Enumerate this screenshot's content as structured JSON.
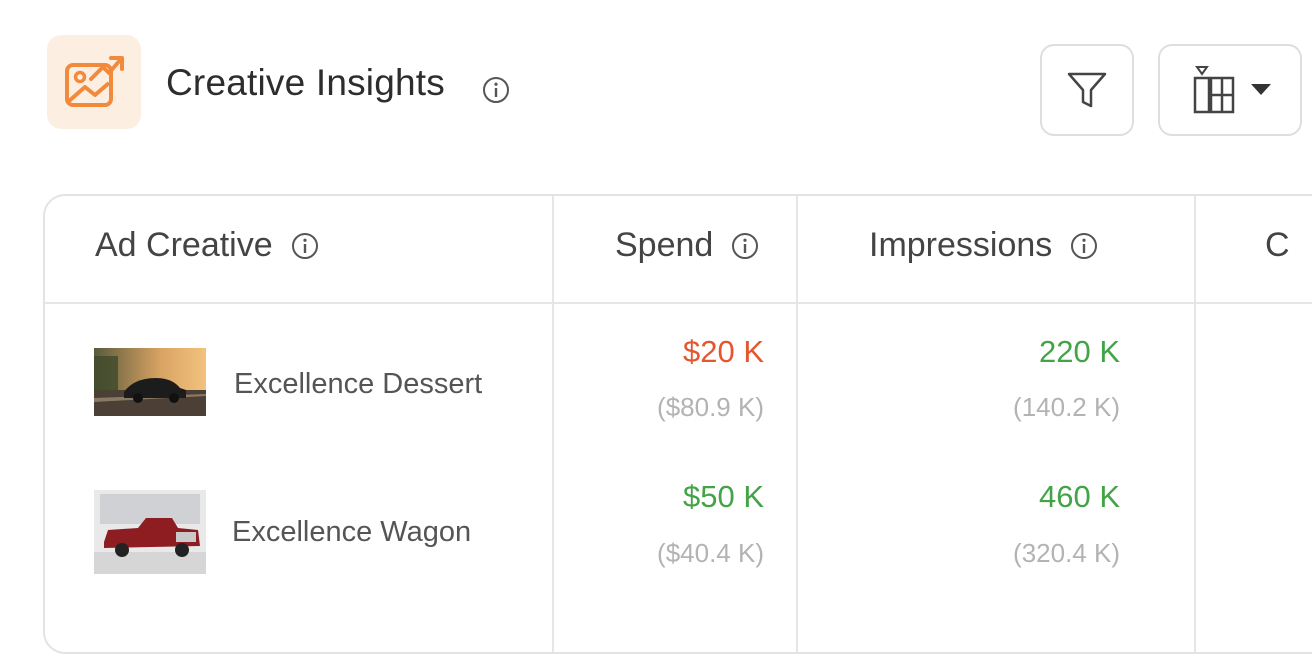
{
  "header": {
    "title": "Creative Insights",
    "icon": "image-trend-icon",
    "accent_color": "#f28a3c"
  },
  "toolbar": {
    "filter_icon": "filter-icon",
    "columns_icon": "columns-icon",
    "dropdown_icon": "caret-down-icon"
  },
  "table": {
    "headers": {
      "creative": "Ad Creative",
      "spend": "Spend",
      "impressions": "Impressions",
      "next": "C"
    },
    "rows": [
      {
        "name": "Excellence Dessert",
        "spend": "$20 K",
        "spend_prev": "($80.9 K)",
        "spend_color": "#e4572e",
        "impressions": "220 K",
        "impressions_prev": "(140.2 K)",
        "impressions_color": "#43a447"
      },
      {
        "name": "Excellence Wagon",
        "spend": "$50 K",
        "spend_prev": "($40.4 K)",
        "spend_color": "#43a447",
        "impressions": "460 K",
        "impressions_prev": "(320.4 K)",
        "impressions_color": "#43a447"
      }
    ]
  }
}
